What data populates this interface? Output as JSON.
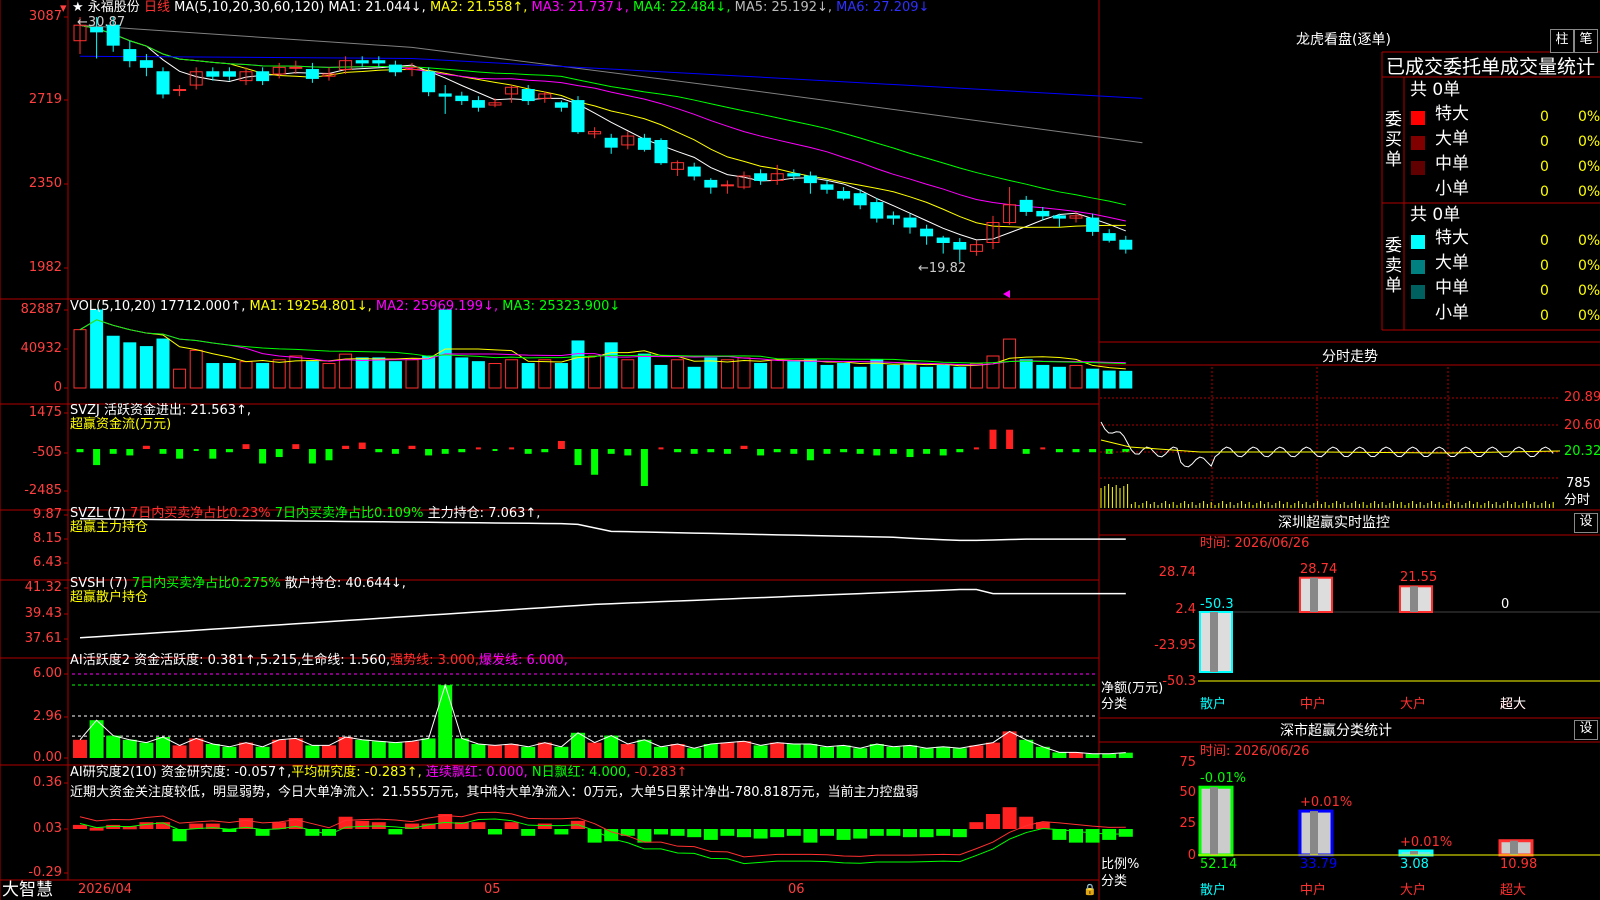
{
  "colors": {
    "up": "#ff3030",
    "down": "#00ffff",
    "grid": "#b00000",
    "ma1": "#ffffff",
    "ma2": "#ffff00",
    "ma3": "#ff00ff",
    "ma4": "#00ff00",
    "ma5": "#808080",
    "ma6": "#0000ff"
  },
  "main": {
    "star": "★",
    "stock_name": "永福股份",
    "period": "日线",
    "ma_items": [
      {
        "text": "MA(5,10,20,30,60,120)",
        "color": "#ffffff"
      },
      {
        "text": "MA1: 21.044↓,",
        "color": "#ffffff"
      },
      {
        "text": "MA2: 21.558↑,",
        "color": "#ffff00"
      },
      {
        "text": "MA3: 21.737↓,",
        "color": "#ff00ff"
      },
      {
        "text": "MA4: 22.484↓,",
        "color": "#00ff00"
      },
      {
        "text": "MA5: 25.192↓,",
        "color": "#bbbbbb"
      },
      {
        "text": "MA6: 27.209↓",
        "color": "#3030ff"
      }
    ],
    "y_labels": [
      "3087",
      "2719",
      "2350",
      "1982"
    ],
    "high_label": "←30.87",
    "low_label": "←19.82"
  },
  "vol": {
    "title": "VOL(5,10,20)",
    "value": "17712.000↑,",
    "ma1": "MA1: 19254.801↓,",
    "ma2": "MA2: 25969.199↓,",
    "ma3": "MA3: 25323.900↓",
    "y_labels": [
      "82887",
      "40932",
      "0"
    ]
  },
  "svzj": {
    "title": "SVZJ  活跃资金进出: 21.563↑,",
    "subtitle": "超赢资金流(万元)",
    "y_labels": [
      "1475",
      "-505",
      "-2485"
    ]
  },
  "svzl": {
    "name": "SVZL (7) ",
    "t1": "7日内买卖净占比0.23%",
    "t2": " 7日内买卖净占比0.109%",
    "t3": " 主力持仓: 7.063↑,",
    "subtitle": "超赢主力持仓",
    "y_labels": [
      "9.87",
      "8.15",
      "6.43"
    ]
  },
  "svsh": {
    "name": "SVSH (7) ",
    "t1": "7日内买卖净占比0.275%",
    "t2": " 散户持仓: 40.644↓,",
    "subtitle": "超赢散户持仓",
    "y_labels": [
      "41.32",
      "39.43",
      "37.61"
    ]
  },
  "ai1": {
    "t1": "AI活跃度2 资金活跃度: 0.381↑,5.215,生命线: 1.560,",
    "t2": "强势线: 3.000,",
    "t3": "爆发线: 6.000,",
    "y_labels": [
      "6.00",
      "2.96",
      "0.00"
    ]
  },
  "ai2": {
    "t1": "AI研究度2(10) 资金研究度: -0.057↑,",
    "t2": "平均研究度: -0.283↑,",
    "t3": "连续飘红: 0.000,",
    "t4": "N日飘红: 4.000,",
    "t5": "-0.283↑",
    "summary": "近期大资金关注度较低，明显弱势，今日大单净流入：21.555万元，其中特大单净流入：0万元，大单5日累计净出-780.818万元，当前主力控盘弱",
    "y_labels": [
      "0.36",
      "0.03",
      "-0.29"
    ]
  },
  "footer": {
    "brand": "大智慧",
    "date": "2026/04",
    "m1": "05",
    "m2": "06"
  },
  "right": {
    "lhkp_title": "龙虎看盘(逐单)",
    "btn1": "柱",
    "btn2": "笔",
    "table_title": "已成交委托单成交量统计",
    "buy_label": "委买单",
    "sell_label": "委卖单",
    "buy_total": "共 0单",
    "sell_total": "共 0单",
    "buy_rows": [
      {
        "name": "特大",
        "vol": "0",
        "pct": "0%",
        "color": "#ff0000"
      },
      {
        "name": "大单",
        "vol": "0",
        "pct": "0%",
        "color": "#800000"
      },
      {
        "name": "中单",
        "vol": "0",
        "pct": "0%",
        "color": "#600000"
      },
      {
        "name": "小单",
        "vol": "0",
        "pct": "0%",
        "color": ""
      }
    ],
    "sell_rows": [
      {
        "name": "特大",
        "vol": "0",
        "pct": "0%",
        "color": "#00ffff"
      },
      {
        "name": "大单",
        "vol": "0",
        "pct": "0%",
        "color": "#008080"
      },
      {
        "name": "中单",
        "vol": "0",
        "pct": "0%",
        "color": "#006060"
      },
      {
        "name": "小单",
        "vol": "0",
        "pct": "0%",
        "color": ""
      }
    ],
    "fs_title": "分时走势",
    "fs_y": [
      "20.89",
      "20.60",
      "20.32"
    ],
    "fs_vol": "785",
    "fs_unit": "分时",
    "sz_title": "深圳超赢实时监控",
    "sz_btn": "设",
    "sz_time": "时间: 2026/06/26",
    "sz_y": [
      "28.74",
      "2.4",
      "-23.95",
      "-50.3"
    ],
    "sz_bars": [
      {
        "cat": "散户",
        "value": -50.3,
        "label": "-50.3",
        "color": "#00ffff"
      },
      {
        "cat": "中户",
        "value": 28.74,
        "label": "28.74",
        "color": "#ff3030"
      },
      {
        "cat": "大户",
        "value": 21.55,
        "label": "21.55",
        "color": "#ff3030"
      },
      {
        "cat": "超大",
        "value": 0,
        "label": "0",
        "color": "#ffffff"
      }
    ],
    "sz_ylabel": "净额(万元)",
    "sz_xlabel": "分类",
    "ss_title": "深市超赢分类统计",
    "ss_btn": "设",
    "ss_time": "时间: 2026/06/26",
    "ss_y": [
      "75",
      "50",
      "25",
      "0"
    ],
    "ss_bars": [
      {
        "cat": "散户",
        "value": 52.14,
        "label": "52.14",
        "top": "-0.01%",
        "color": "#00ff00"
      },
      {
        "cat": "中户",
        "value": 33.79,
        "label": "33.79",
        "top": "+0.01%",
        "color": "#0000ff"
      },
      {
        "cat": "大户",
        "value": 3.08,
        "label": "3.08",
        "top": "+0.01%",
        "color": "#00ffff"
      },
      {
        "cat": "超大",
        "value": 10.98,
        "label": "10.98",
        "top": "",
        "color": "#ff3030"
      }
    ],
    "ss_ylabel": "比例%",
    "ss_xlabel": "分类"
  },
  "chart_data": {
    "type": "candlestick",
    "price_range": [
      19.82,
      30.87
    ],
    "candles": [
      [
        29.8,
        30.5,
        30.87,
        29.2
      ],
      [
        30.4,
        30.2,
        30.87,
        29.0
      ],
      [
        30.5,
        29.6,
        30.87,
        29.3
      ],
      [
        29.4,
        28.9,
        29.8,
        28.6
      ],
      [
        28.9,
        28.6,
        29.2,
        28.2
      ],
      [
        28.4,
        27.4,
        28.6,
        27.2
      ],
      [
        27.6,
        27.6,
        27.8,
        27.3
      ],
      [
        27.8,
        28.4,
        28.6,
        27.6
      ],
      [
        28.4,
        28.2,
        28.6,
        28.0
      ],
      [
        28.4,
        28.2,
        28.6,
        28.0
      ],
      [
        28.0,
        28.4,
        28.6,
        27.8
      ],
      [
        28.4,
        28.0,
        28.6,
        27.8
      ],
      [
        28.3,
        28.6,
        28.8,
        28.1
      ],
      [
        28.6,
        28.6,
        28.9,
        28.3
      ],
      [
        28.5,
        28.1,
        28.8,
        27.9
      ],
      [
        28.2,
        28.3,
        28.6,
        28.0
      ],
      [
        28.5,
        28.9,
        29.1,
        28.3
      ],
      [
        28.9,
        28.8,
        29.1,
        28.6
      ],
      [
        28.9,
        28.8,
        29.1,
        28.6
      ],
      [
        28.7,
        28.4,
        28.9,
        28.2
      ],
      [
        28.5,
        28.6,
        28.8,
        28.2
      ],
      [
        28.4,
        27.5,
        28.6,
        27.3
      ],
      [
        27.4,
        27.3,
        27.8,
        26.5
      ],
      [
        27.3,
        27.1,
        27.5,
        26.9
      ],
      [
        27.1,
        26.8,
        27.3,
        26.6
      ],
      [
        26.9,
        27.0,
        27.2,
        26.8
      ],
      [
        27.4,
        27.7,
        27.8,
        27.0
      ],
      [
        27.6,
        27.1,
        27.8,
        26.9
      ],
      [
        27.2,
        27.4,
        27.5,
        27.0
      ],
      [
        27.0,
        26.8,
        27.1,
        26.6
      ],
      [
        27.1,
        25.7,
        27.3,
        25.6
      ],
      [
        25.6,
        25.7,
        25.9,
        25.4
      ],
      [
        25.4,
        25.0,
        25.6,
        24.7
      ],
      [
        25.1,
        25.5,
        25.7,
        24.9
      ],
      [
        25.4,
        24.9,
        25.6,
        24.8
      ],
      [
        25.3,
        24.3,
        25.4,
        24.2
      ],
      [
        24.0,
        24.3,
        24.4,
        23.7
      ],
      [
        24.1,
        23.7,
        24.3,
        23.5
      ],
      [
        23.5,
        23.2,
        23.6,
        22.9
      ],
      [
        23.3,
        23.3,
        23.5,
        22.9
      ],
      [
        23.2,
        23.7,
        23.9,
        23.1
      ],
      [
        23.8,
        23.5,
        24.0,
        23.3
      ],
      [
        23.5,
        23.8,
        24.2,
        23.3
      ],
      [
        23.8,
        23.7,
        24.0,
        23.5
      ],
      [
        23.7,
        23.4,
        23.9,
        22.9
      ],
      [
        23.3,
        23.1,
        23.5,
        22.9
      ],
      [
        23.0,
        22.7,
        23.2,
        22.6
      ],
      [
        22.9,
        22.4,
        23.1,
        22.2
      ],
      [
        22.5,
        21.8,
        22.7,
        21.6
      ],
      [
        21.9,
        21.8,
        22.1,
        21.5
      ],
      [
        21.8,
        21.4,
        22.0,
        21.1
      ],
      [
        21.3,
        21.0,
        21.5,
        20.6
      ],
      [
        20.9,
        20.7,
        21.0,
        20.2
      ],
      [
        20.7,
        20.4,
        20.9,
        19.82
      ],
      [
        20.3,
        20.6,
        20.8,
        20.1
      ],
      [
        20.7,
        21.6,
        21.9,
        20.4
      ],
      [
        21.6,
        22.4,
        23.2,
        21.5
      ],
      [
        22.6,
        22.1,
        22.8,
        21.9
      ],
      [
        22.1,
        21.9,
        22.3,
        21.7
      ],
      [
        21.9,
        21.8,
        22.0,
        21.4
      ],
      [
        21.8,
        21.9,
        22.1,
        21.6
      ],
      [
        21.8,
        21.2,
        22.0,
        21.0
      ],
      [
        21.1,
        20.8,
        21.3,
        20.7
      ],
      [
        20.8,
        20.4,
        21.0,
        20.2
      ]
    ],
    "volume": [
      62000,
      82887,
      55000,
      48000,
      44000,
      52000,
      20000,
      40000,
      26000,
      26000,
      28000,
      26000,
      30000,
      34000,
      28000,
      26000,
      36000,
      32000,
      32000,
      28000,
      30000,
      34000,
      82887,
      32000,
      28000,
      26000,
      30000,
      26000,
      30000,
      26000,
      50000,
      34000,
      48000,
      30000,
      36000,
      24000,
      30000,
      22000,
      32000,
      30000,
      32000,
      26000,
      30000,
      28000,
      30000,
      24000,
      26000,
      22000,
      30000,
      24000,
      26000,
      22000,
      24000,
      22000,
      26000,
      34000,
      52000,
      30000,
      24000,
      22000,
      24000,
      20000,
      18000,
      17712
    ],
    "svzj": [
      -200,
      -1000,
      -300,
      -400,
      200,
      -300,
      -600,
      -100,
      -600,
      -200,
      300,
      -900,
      -500,
      300,
      -900,
      -700,
      200,
      400,
      -200,
      -300,
      200,
      -400,
      -300,
      -200,
      100,
      -100,
      100,
      -300,
      -200,
      500,
      -1000,
      -1600,
      -300,
      -400,
      -2300,
      100,
      -200,
      -300,
      -200,
      -300,
      200,
      -400,
      -200,
      -300,
      -700,
      -300,
      -200,
      -300,
      -400,
      -300,
      -500,
      -300,
      -400,
      -200,
      100,
      1200,
      1200,
      -300,
      100,
      -200,
      -200,
      -200,
      -300,
      -200
    ],
    "ai_act": [
      1.3,
      2.7,
      1.6,
      1.3,
      1.1,
      1.5,
      0.9,
      1.4,
      1.0,
      0.8,
      1.1,
      0.8,
      1.3,
      1.4,
      0.9,
      0.9,
      1.5,
      1.3,
      1.2,
      1.1,
      1.2,
      1.4,
      5.2,
      1.4,
      1.0,
      0.9,
      1.0,
      0.8,
      1.1,
      0.8,
      1.8,
      1.1,
      1.6,
      1.0,
      1.3,
      0.8,
      1.0,
      0.7,
      1.0,
      1.1,
      1.2,
      0.9,
      1.1,
      1.0,
      1.0,
      0.8,
      0.9,
      0.7,
      1.0,
      0.8,
      0.9,
      0.7,
      0.8,
      0.7,
      0.9,
      1.1,
      1.9,
      1.3,
      0.8,
      0.4,
      0.4,
      0.3,
      0.3,
      0.38
    ],
    "ai_res": [
      0.03,
      0.01,
      0.03,
      0.02,
      0.05,
      0.05,
      -0.09,
      0.04,
      0.04,
      -0.02,
      0.08,
      -0.05,
      0.05,
      0.08,
      -0.05,
      -0.05,
      0.09,
      0.06,
      0.05,
      -0.04,
      0.04,
      0.04,
      0.11,
      0.05,
      0.05,
      -0.04,
      0.05,
      -0.05,
      0.04,
      -0.04,
      0.06,
      -0.1,
      -0.09,
      -0.05,
      -0.1,
      -0.04,
      -0.05,
      -0.06,
      -0.08,
      -0.05,
      -0.06,
      -0.07,
      -0.06,
      -0.05,
      -0.1,
      -0.05,
      -0.08,
      -0.07,
      -0.05,
      -0.05,
      -0.06,
      -0.06,
      -0.05,
      -0.06,
      0.05,
      0.11,
      0.16,
      0.09,
      0.05,
      -0.08,
      -0.1,
      -0.1,
      -0.08,
      -0.057
    ]
  }
}
